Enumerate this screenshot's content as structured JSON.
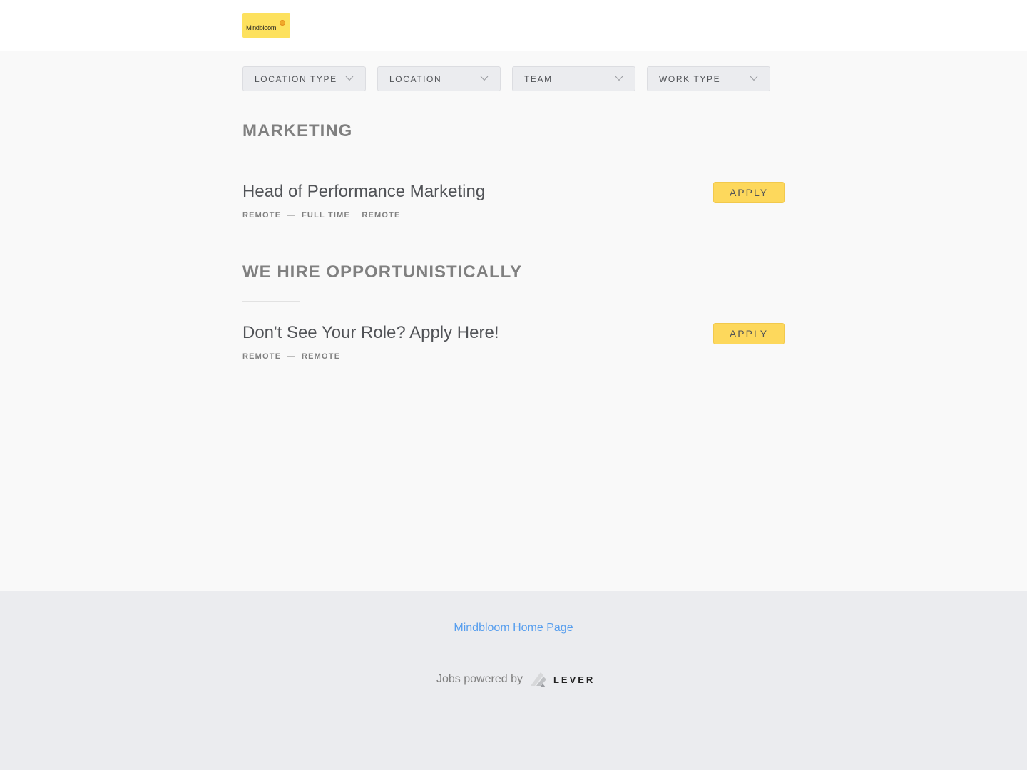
{
  "brand": {
    "logo_text": "Mindbloom",
    "logo_color": "#fde15e"
  },
  "filters": [
    {
      "label": "LOCATION TYPE",
      "icon": "chevron-down-icon"
    },
    {
      "label": "LOCATION",
      "icon": "chevron-down-icon"
    },
    {
      "label": "TEAM",
      "icon": "chevron-down-icon"
    },
    {
      "label": "WORK TYPE",
      "icon": "chevron-down-icon"
    }
  ],
  "groups": [
    {
      "title": "MARKETING",
      "postings": [
        {
          "title": "Head of Performance Marketing",
          "location": "REMOTE",
          "separator": "—",
          "commitment": "FULL TIME",
          "workplace": "REMOTE",
          "apply_label": "APPLY"
        }
      ]
    },
    {
      "title": "WE HIRE OPPORTUNISTICALLY",
      "postings": [
        {
          "title": "Don't See Your Role? Apply Here!",
          "location": "REMOTE",
          "separator": "—",
          "commitment": "",
          "workplace": "REMOTE",
          "apply_label": "APPLY"
        }
      ]
    }
  ],
  "footer": {
    "home_link": "Mindbloom Home Page",
    "powered_by": "Jobs powered by",
    "lever_wordmark": "LEVER",
    "lever_icon": "lever-logo-icon"
  },
  "colors": {
    "accent": "#fdd85c",
    "link": "#579eee",
    "background": "#f9f9f9",
    "footer_background": "#ebecef"
  }
}
